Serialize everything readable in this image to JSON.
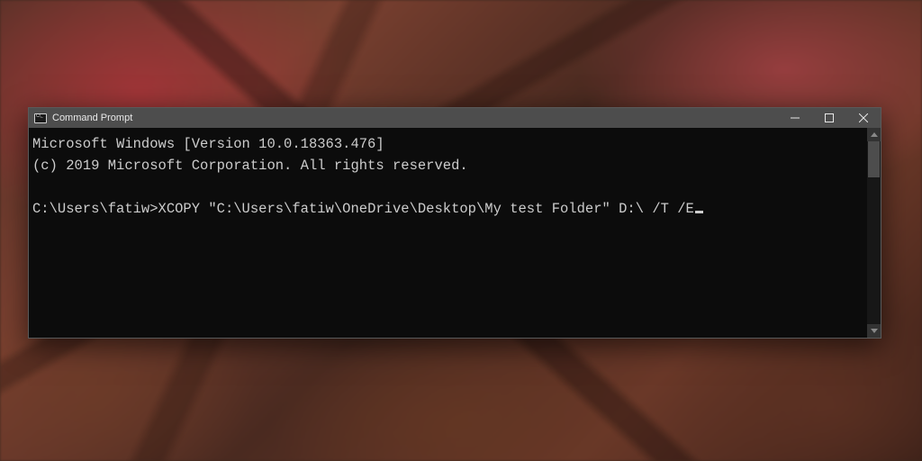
{
  "window": {
    "title": "Command Prompt"
  },
  "terminal": {
    "header_line1": "Microsoft Windows [Version 10.0.18363.476]",
    "header_line2": "(c) 2019 Microsoft Corporation. All rights reserved.",
    "prompt": "C:\\Users\\fatiw>",
    "command": "XCOPY \"C:\\Users\\fatiw\\OneDrive\\Desktop\\My test Folder\" D:\\ /T /E"
  }
}
